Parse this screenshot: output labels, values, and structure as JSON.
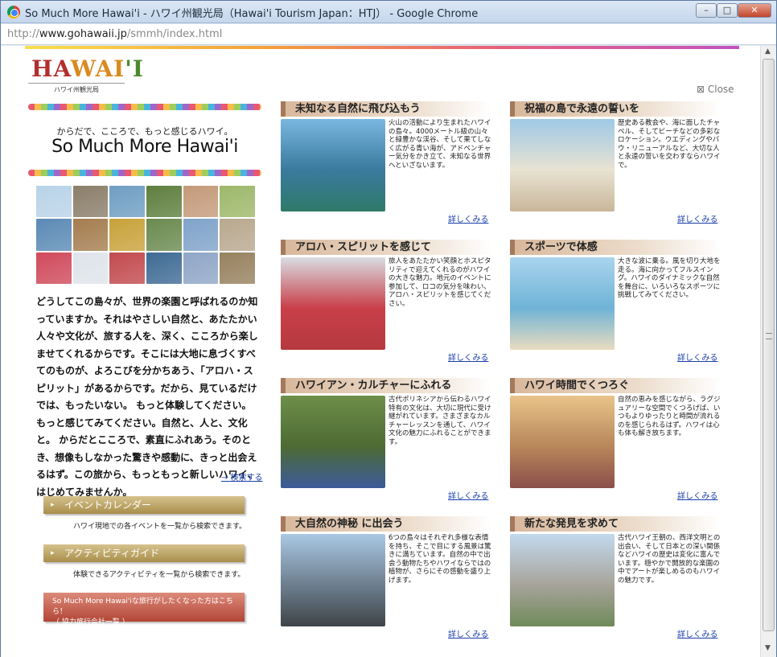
{
  "window": {
    "title": "So Much More Hawai'i - ハワイ州観光局（Hawai'i Tourism Japan：HTJ） - Google Chrome",
    "url_scheme": "http://",
    "url_domain": "www.gohawaii.jp",
    "url_path": "/smmh/index.html",
    "buttons": {
      "minimize": "–",
      "maximize": "□",
      "close": "✕"
    }
  },
  "brand": {
    "logo_parts": [
      "HA",
      "WAI",
      "'I"
    ],
    "logo_sub": "ハワイ州観光局"
  },
  "close_label": "Close",
  "tagline_jp": "からだで、こころで、もっと感じるハワイ。",
  "tagline_en": "So Much More Hawai'i",
  "mosaic_colors": [
    "#b9d3e8",
    "#8b7e6a",
    "#6f9ec2",
    "#5e7f3e",
    "#c49a7a",
    "#9db86a",
    "#5b8ab5",
    "#a57d4f",
    "#c8a23a",
    "#6a8a4f",
    "#7fa3c9",
    "#b8a88e",
    "#d04a5b",
    "#dfe4ea",
    "#c24a4f",
    "#3f6b94",
    "#8fa6c7",
    "#97815e"
  ],
  "intro_text": "どうしてこの島々が、世界の楽園と呼ばれるのか知っていますか。それはやさしい自然と、あたたかい人々や文化が、旅する人を、深く、こころから楽しませてくれるからです。そこには大地に息づくすべてのものが、よろこびを分かちあう、「アロハ・スピリット」があるからです。だから、見ているだけでは、もったいない。 もっと体験してください。もっと感じてみてください。自然と、人と、文化と。 からだとこころで、素直にふれあう。そのとき、想像もしなかった驚きや感動に、きっと出会えるはず。この旅から、もっともっと新しいハワイ、はじめてみませんか。",
  "search_link": "→ 検索する",
  "event_calendar": {
    "label": "イベントカレンダー",
    "desc": "ハワイ現地での各イベントを一覧から検索できます。"
  },
  "activity_guide": {
    "label": "アクティビティガイド",
    "desc": "体験できるアクティビティを一覧から検索できます。"
  },
  "travel_cta": {
    "line1": "So Much More Hawai'iな旅行がしたくなった方はこちら！",
    "line2": "（ 協力旅行会社一覧 ）"
  },
  "more_label": "詳しくみる",
  "cards": [
    {
      "title": "未知なる自然に飛び込もう",
      "text": "火山の活動により生まれたハワイの島々。4000メートル級の山々と緑豊かな渓谷、そして果てしなく広がる青い海が、アドベンチャー気分をかき立て、未知なる世界へといざないます。",
      "colors": [
        "#7ab7e0",
        "#3a7a9e",
        "#2f7a6a"
      ]
    },
    {
      "title": "祝福の島で永遠の誓いを",
      "text": "歴史ある教会や、海に面したチャペル、そしてビーチなどの多彩なロケーション。ウエディングやバウ・リニューアルなど、大切な人と永遠の誓いを交わすならハワイで。",
      "colors": [
        "#9fc9e6",
        "#e8e2d2",
        "#c9b79a"
      ]
    },
    {
      "title": "アロハ・スピリットを感じて",
      "text": "旅人をあたたかい笑顔とホスピタリティで迎えてくれるのがハワイの大きな魅力。地元のイベントに参加して、ロコの気分を味わい、アロハ・スピリットを感じてください。",
      "colors": [
        "#d9dde3",
        "#c93f4a",
        "#b53a3e"
      ]
    },
    {
      "title": "スポーツで体感",
      "text": "大きな波に乗る。風を切り大地を走る。海に向かってフルスイング。ハワイのダイナミックな自然を舞台に、いろいろなスポーツに挑戦してみてください。",
      "colors": [
        "#a9d4ee",
        "#6fb3d6",
        "#e9dcc0"
      ]
    },
    {
      "title": "ハワイアン・カルチャーにふれる",
      "text": "古代ポリネシアから伝わるハワイ特有の文化は、大切に現代に受け継がれています。さまざまなカルチャーレッスンを通して、ハワイ文化の魅力にふれることができます。",
      "colors": [
        "#6e8f4a",
        "#4d6b34",
        "#3c5a9a"
      ]
    },
    {
      "title": "ハワイ時間でくつろぐ",
      "text": "自然の恵みを感じながら、ラグジュアリーな空間でくつろげば、いつもよりゆったりと時間が流れるのを感じられるはず。ハワイは心も体も解き放ちます。",
      "colors": [
        "#e9c48a",
        "#b8865a",
        "#8a4f4a"
      ]
    },
    {
      "title": "大自然の神秘 に出会う",
      "text": "6つの島々はそれぞれ多様な表情を持ち、そこで目にする風景は驚きに満ちています。自然の中で出会う動物たちやハワイならではの植物が、さらにその感動を盛り上げます。",
      "colors": [
        "#aac8e4",
        "#6d7f8f",
        "#3f4448"
      ]
    },
    {
      "title": "新たな発見を求めて",
      "text": "古代ハワイ王朝の、西洋文明との出会い、そして日本との深い関係などハワイの歴史は変化に富んでいます。穏やかで開放的な楽園の中でアートが楽しめるのもハワイの魅力です。",
      "colors": [
        "#c3d9ee",
        "#a7a49a",
        "#6f8a5a"
      ]
    }
  ]
}
